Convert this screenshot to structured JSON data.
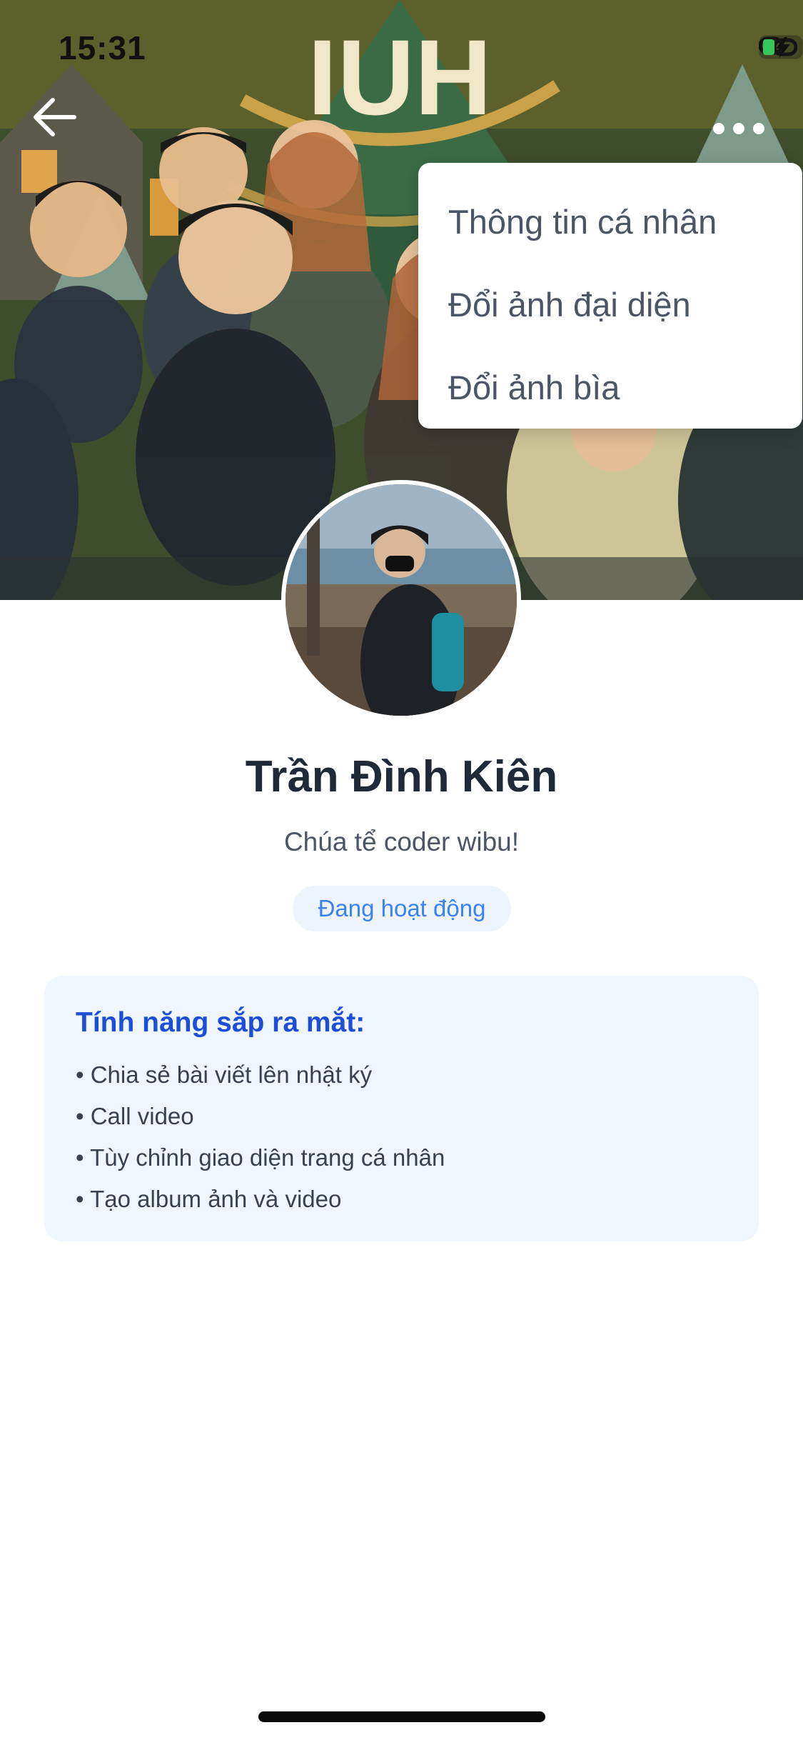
{
  "status_bar": {
    "time": "15:31"
  },
  "cover": {
    "sign_text": "IUH"
  },
  "menu": {
    "items": [
      {
        "label": "Thông tin cá nhân"
      },
      {
        "label": "Đổi ảnh đại diện"
      },
      {
        "label": "Đổi ảnh bìa"
      }
    ]
  },
  "profile": {
    "name": "Trần Đình Kiên",
    "bio": "Chúa tể coder wibu!",
    "status": "Đang hoạt động"
  },
  "features": {
    "title": "Tính năng sắp ra mắt:",
    "items": [
      {
        "label": "• Chia sẻ bài viết lên nhật ký"
      },
      {
        "label": "• Call video"
      },
      {
        "label": "• Tùy chỉnh giao diện trang cá nhân"
      },
      {
        "label": "• Tạo album ảnh và video"
      }
    ]
  },
  "colors": {
    "accent_blue": "#3b82f6",
    "title_blue": "#1d4ed8",
    "card_bg": "#eff6ff",
    "pill_bg": "#eef4fe"
  },
  "icons": {
    "back": "arrow-left-icon",
    "more": "more-horizontal-icon",
    "link": "link-icon",
    "battery": "battery-charging-icon"
  }
}
